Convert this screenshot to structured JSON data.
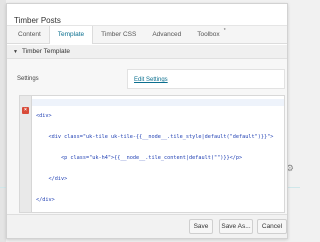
{
  "panel": {
    "title": "Timber Posts"
  },
  "tabs": [
    {
      "label": "Content"
    },
    {
      "label": "Template"
    },
    {
      "label": "Timber CSS"
    },
    {
      "label": "Advanced"
    },
    {
      "label": "Toolbox",
      "superscript": "*"
    }
  ],
  "section": {
    "title": "Timber Template",
    "settings_label": "Settings",
    "edit_settings_link": "Edit Settings"
  },
  "editor": {
    "lines": [
      "<div>",
      "    <div class=\"uk-tile uk-tile-{{__node__.tile_style|default(\"default\")}}\">",
      "        <p class=\"uk-h4\">{{__node__.tile_content|default(\"\")}}</p>",
      "    </div>",
      "</div>"
    ],
    "error_marker": "×"
  },
  "footer": {
    "save": "Save",
    "save_as": "Save As...",
    "cancel": "Cancel"
  },
  "icons": {
    "caret": "▼",
    "gear": "⚙"
  }
}
